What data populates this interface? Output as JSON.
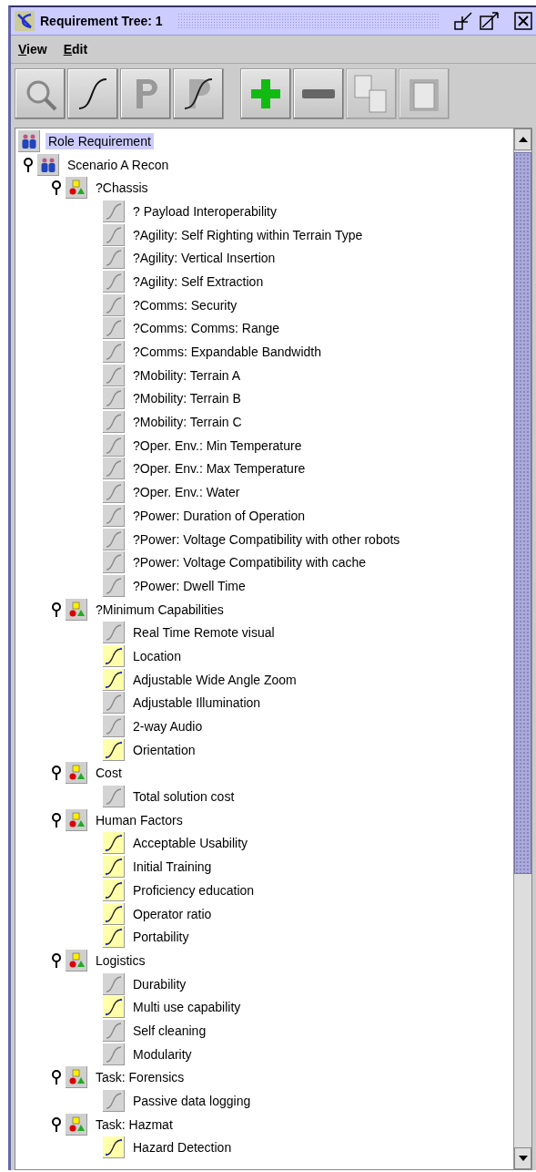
{
  "window": {
    "title": "Requirement Tree: 1"
  },
  "menu": [
    {
      "label": "View"
    },
    {
      "label": "Edit"
    }
  ],
  "toolbar": [
    {
      "kind": "inspect",
      "disabled": false
    },
    {
      "kind": "curve",
      "disabled": false
    },
    {
      "kind": "p",
      "disabled": false
    },
    {
      "kind": "p-curve",
      "disabled": false
    },
    {
      "kind": "add",
      "disabled": false
    },
    {
      "kind": "remove",
      "disabled": false
    },
    {
      "kind": "copy",
      "disabled": true
    },
    {
      "kind": "paste",
      "disabled": true
    }
  ],
  "tree": [
    {
      "label": "Role Requirement",
      "kind": "role",
      "selected": true,
      "children": [
        {
          "label": "Scenario A Recon",
          "kind": "role",
          "selected": false,
          "expanded": true,
          "children": [
            {
              "label": "?Chassis",
              "kind": "category",
              "selected": false,
              "expanded": true,
              "children": [
                {
                  "label": "? Payload Interoperability",
                  "kind": "requirement",
                  "selected": false,
                  "highlighted": false
                },
                {
                  "label": "?Agility: Self Righting within Terrain Type",
                  "kind": "requirement",
                  "selected": false,
                  "highlighted": false
                },
                {
                  "label": "?Agility: Vertical Insertion",
                  "kind": "requirement",
                  "selected": false,
                  "highlighted": false
                },
                {
                  "label": "?Agility:  Self Extraction",
                  "kind": "requirement",
                  "selected": false,
                  "highlighted": false
                },
                {
                  "label": "?Comms: Security",
                  "kind": "requirement",
                  "selected": false,
                  "highlighted": false
                },
                {
                  "label": "?Comms: Comms: Range",
                  "kind": "requirement",
                  "selected": false,
                  "highlighted": false
                },
                {
                  "label": "?Comms: Expandable Bandwidth",
                  "kind": "requirement",
                  "selected": false,
                  "highlighted": false
                },
                {
                  "label": "?Mobility: Terrain A",
                  "kind": "requirement",
                  "selected": false,
                  "highlighted": false
                },
                {
                  "label": "?Mobility: Terrain B",
                  "kind": "requirement",
                  "selected": false,
                  "highlighted": false
                },
                {
                  "label": "?Mobility: Terrain C",
                  "kind": "requirement",
                  "selected": false,
                  "highlighted": false
                },
                {
                  "label": "?Oper. Env.: Min Temperature",
                  "kind": "requirement",
                  "selected": false,
                  "highlighted": false
                },
                {
                  "label": "?Oper. Env.: Max Temperature",
                  "kind": "requirement",
                  "selected": false,
                  "highlighted": false
                },
                {
                  "label": "?Oper. Env.: Water",
                  "kind": "requirement",
                  "selected": false,
                  "highlighted": false
                },
                {
                  "label": "?Power: Duration of Operation",
                  "kind": "requirement",
                  "selected": false,
                  "highlighted": false
                },
                {
                  "label": "?Power: Voltage Compatibility with other robots",
                  "kind": "requirement",
                  "selected": false,
                  "highlighted": false
                },
                {
                  "label": "?Power: Voltage Compatibility with cache",
                  "kind": "requirement",
                  "selected": false,
                  "highlighted": false
                },
                {
                  "label": "?Power: Dwell Time",
                  "kind": "requirement",
                  "selected": false,
                  "highlighted": false
                }
              ]
            },
            {
              "label": "?Minimum Capabilities",
              "kind": "category",
              "selected": false,
              "expanded": true,
              "children": [
                {
                  "label": "Real Time Remote visual",
                  "kind": "requirement",
                  "selected": false,
                  "highlighted": false
                },
                {
                  "label": "Location",
                  "kind": "requirement",
                  "selected": false,
                  "highlighted": true
                },
                {
                  "label": "Adjustable Wide Angle Zoom",
                  "kind": "requirement",
                  "selected": false,
                  "highlighted": true
                },
                {
                  "label": "Adjustable Illumination",
                  "kind": "requirement",
                  "selected": false,
                  "highlighted": false
                },
                {
                  "label": "2-way Audio",
                  "kind": "requirement",
                  "selected": false,
                  "highlighted": false
                },
                {
                  "label": "Orientation",
                  "kind": "requirement",
                  "selected": false,
                  "highlighted": true
                }
              ]
            },
            {
              "label": "Cost",
              "kind": "category",
              "selected": false,
              "expanded": true,
              "children": [
                {
                  "label": "Total solution cost",
                  "kind": "requirement",
                  "selected": false,
                  "highlighted": false
                }
              ]
            },
            {
              "label": "Human Factors",
              "kind": "category",
              "selected": false,
              "expanded": true,
              "children": [
                {
                  "label": "Acceptable Usability",
                  "kind": "requirement",
                  "selected": false,
                  "highlighted": true
                },
                {
                  "label": "Initial Training",
                  "kind": "requirement",
                  "selected": false,
                  "highlighted": true
                },
                {
                  "label": "Proficiency education",
                  "kind": "requirement",
                  "selected": false,
                  "highlighted": true
                },
                {
                  "label": "Operator ratio",
                  "kind": "requirement",
                  "selected": false,
                  "highlighted": true
                },
                {
                  "label": "Portability",
                  "kind": "requirement",
                  "selected": false,
                  "highlighted": true
                }
              ]
            },
            {
              "label": "Logistics",
              "kind": "category",
              "selected": false,
              "expanded": true,
              "children": [
                {
                  "label": "Durability",
                  "kind": "requirement",
                  "selected": false,
                  "highlighted": false
                },
                {
                  "label": "Multi use capability",
                  "kind": "requirement",
                  "selected": false,
                  "highlighted": true
                },
                {
                  "label": "Self cleaning",
                  "kind": "requirement",
                  "selected": false,
                  "highlighted": false
                },
                {
                  "label": "Modularity",
                  "kind": "requirement",
                  "selected": false,
                  "highlighted": false
                }
              ]
            },
            {
              "label": "Task: Forensics",
              "kind": "category",
              "selected": false,
              "expanded": true,
              "children": [
                {
                  "label": "Passive data logging",
                  "kind": "requirement",
                  "selected": false,
                  "highlighted": false
                }
              ]
            },
            {
              "label": "Task: Hazmat",
              "kind": "category",
              "selected": false,
              "expanded": true,
              "children": [
                {
                  "label": "Hazard Detection",
                  "kind": "requirement",
                  "selected": false,
                  "highlighted": true
                }
              ]
            }
          ]
        }
      ]
    }
  ]
}
